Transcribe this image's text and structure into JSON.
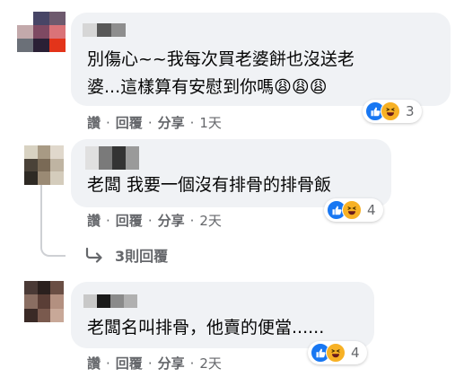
{
  "actions": {
    "like": "讚",
    "reply": "回覆",
    "share": "分享"
  },
  "comments": [
    {
      "text": "別傷心~~我每次買老婆餅也沒送老\n婆...這樣算有安慰到你嗎😩😩😩",
      "time": "1天",
      "reactions": [
        "like-icon",
        "haha-icon"
      ],
      "reaction_count": "3",
      "avatar_colors": [
        "#ffffff",
        "#474566",
        "#6e5a6e",
        "#c3a9ab",
        "#7e4962",
        "#da7378",
        "#6b7078",
        "#2a2035",
        "#e3341a"
      ],
      "name_colors": [
        "#d6d6d6",
        "#585858",
        "#8e8e8e"
      ]
    },
    {
      "text": "老闆 我要一個沒有排骨的排骨飯",
      "time": "2天",
      "reactions": [
        "like-icon",
        "haha-icon"
      ],
      "reaction_count": "4",
      "avatar_colors": [
        "#d8d2c2",
        "#a89a84",
        "#e0d8cc",
        "#4a4238",
        "#7a6a56",
        "#bfb4a2",
        "#2e2a24",
        "#9a8a74",
        "#d4ccbc"
      ],
      "name_colors": [
        "#e0e0e0",
        "#7a7a7a",
        "#333333",
        "#9a9a9a"
      ]
    },
    {
      "text": "老闆名叫排骨，他賣的便當......",
      "time": "2天",
      "reactions": [
        "like-icon",
        "haha-icon"
      ],
      "reaction_count": "4",
      "avatar_colors": [
        "#4a3a36",
        "#2a201e",
        "#6a4e44",
        "#8a6e62",
        "#5a3e36",
        "#b39080",
        "#3a2a26",
        "#7a5a4e",
        "#c8a898"
      ],
      "name_colors": [
        "#c8c8c8",
        "#1a1a1a",
        "#8a8a8a",
        "#b0b0b0"
      ]
    }
  ],
  "replies_link": "3則回覆",
  "colors": {
    "bubble": "#f0f2f5",
    "meta": "#65676b",
    "like": "#1877f2",
    "haha": "#f7b125"
  }
}
